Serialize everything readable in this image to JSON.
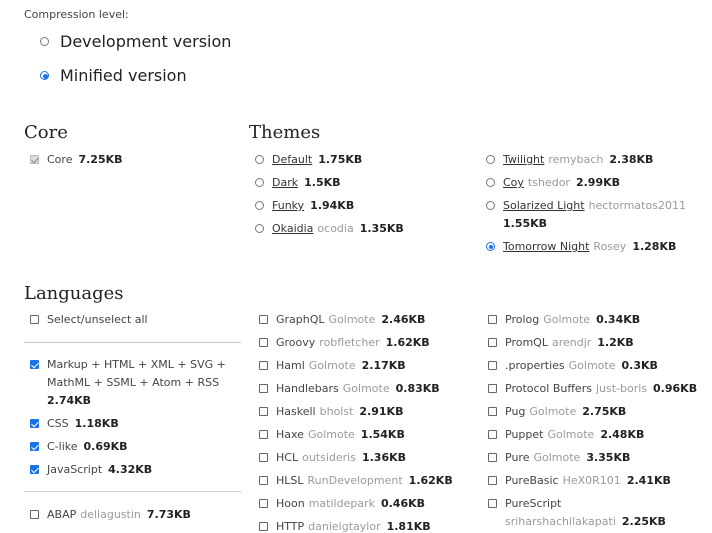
{
  "compression": {
    "label": "Compression level:",
    "options": [
      {
        "label": "Development version",
        "checked": false
      },
      {
        "label": "Minified version",
        "checked": true
      }
    ]
  },
  "core": {
    "heading": "Core",
    "item": {
      "name": "Core",
      "size": "7.25KB"
    }
  },
  "themes": {
    "heading": "Themes",
    "col1": [
      {
        "name": "Default",
        "owner": "",
        "size": "1.75KB"
      },
      {
        "name": "Dark",
        "owner": "",
        "size": "1.5KB"
      },
      {
        "name": "Funky",
        "owner": "",
        "size": "1.94KB"
      },
      {
        "name": "Okaidia",
        "owner": "ocodia",
        "size": "1.35KB"
      }
    ],
    "col2": [
      {
        "name": "Twilight",
        "owner": "remybach",
        "size": "2.38KB"
      },
      {
        "name": "Coy",
        "owner": "tshedor",
        "size": "2.99KB"
      },
      {
        "name": "Solarized Light",
        "owner": "hectormatos2011",
        "size": "1.55KB"
      },
      {
        "name": "Tomorrow Night",
        "owner": "Rosey",
        "size": "1.28KB",
        "checked": true
      }
    ]
  },
  "languages": {
    "heading": "Languages",
    "select_all": "Select/unselect all",
    "checked_items": [
      {
        "name": "Markup + HTML + XML + SVG + MathML + SSML + Atom + RSS",
        "line1": "Markup + HTML + XML + SVG +",
        "line2": "MathML + SSML + Atom + RSS",
        "size": "2.74KB"
      },
      {
        "name": "CSS",
        "size": "1.18KB"
      },
      {
        "name": "C-like",
        "size": "0.69KB"
      },
      {
        "name": "JavaScript",
        "size": "4.32KB"
      }
    ],
    "col1_rest": [
      {
        "name": "ABAP",
        "owner": "dellagustin",
        "size": "7.73KB"
      }
    ],
    "col2": [
      {
        "name": "GraphQL",
        "owner": "Golmote",
        "size": "2.46KB"
      },
      {
        "name": "Groovy",
        "owner": "robfletcher",
        "size": "1.62KB"
      },
      {
        "name": "Haml",
        "owner": "Golmote",
        "size": "2.17KB"
      },
      {
        "name": "Handlebars",
        "owner": "Golmote",
        "size": "0.83KB"
      },
      {
        "name": "Haskell",
        "owner": "bholst",
        "size": "2.91KB"
      },
      {
        "name": "Haxe",
        "owner": "Golmote",
        "size": "1.54KB"
      },
      {
        "name": "HCL",
        "owner": "outsideris",
        "size": "1.36KB"
      },
      {
        "name": "HLSL",
        "owner": "RunDevelopment",
        "size": "1.62KB"
      },
      {
        "name": "Hoon",
        "owner": "matildepark",
        "size": "0.46KB"
      },
      {
        "name": "HTTP",
        "owner": "danielgtaylor",
        "size": "1.81KB"
      }
    ],
    "col3": [
      {
        "name": "Prolog",
        "owner": "Golmote",
        "size": "0.34KB"
      },
      {
        "name": "PromQL",
        "owner": "arendjr",
        "size": "1.2KB"
      },
      {
        "name": ".properties",
        "owner": "Golmote",
        "size": "0.3KB"
      },
      {
        "name": "Protocol Buffers",
        "owner": "just-boris",
        "size": "0.96KB"
      },
      {
        "name": "Pug",
        "owner": "Golmote",
        "size": "2.75KB"
      },
      {
        "name": "Puppet",
        "owner": "Golmote",
        "size": "2.48KB"
      },
      {
        "name": "Pure",
        "owner": "Golmote",
        "size": "3.35KB"
      },
      {
        "name": "PureBasic",
        "owner": "HeX0R101",
        "size": "2.41KB"
      },
      {
        "name": "PureScript",
        "owner": "sriharshachilakapati",
        "size": "2.25KB"
      }
    ]
  }
}
